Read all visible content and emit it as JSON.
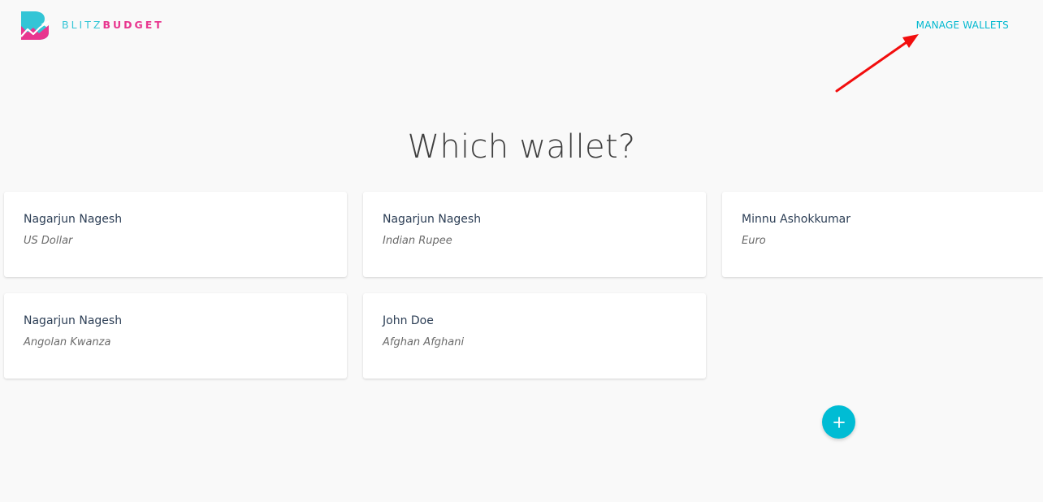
{
  "brand": {
    "name_light": "BLITZ",
    "name_bold": "BUDGET",
    "logo_icon": "blitzbudget-logo-icon",
    "colors": {
      "teal": "#33c5d6",
      "pink": "#e8368f"
    }
  },
  "header": {
    "manage_wallets_label": "MANAGE WALLETS"
  },
  "main": {
    "title": "Which wallet?",
    "wallets": [
      {
        "owner": "Nagarjun Nagesh",
        "currency": "US Dollar"
      },
      {
        "owner": "Nagarjun Nagesh",
        "currency": "Indian Rupee"
      },
      {
        "owner": "Minnu Ashokkumar",
        "currency": "Euro"
      },
      {
        "owner": "Nagarjun Nagesh",
        "currency": "Angolan Kwanza"
      },
      {
        "owner": "John Doe",
        "currency": "Afghan Afghani"
      }
    ],
    "add_button_icon": "plus-icon"
  },
  "annotation": {
    "arrow_icon": "red-arrow-icon",
    "color": "#f20e0e"
  },
  "colors": {
    "accent": "#00bcd4",
    "title": "#3f3f3f",
    "background": "#f9f9f9"
  }
}
